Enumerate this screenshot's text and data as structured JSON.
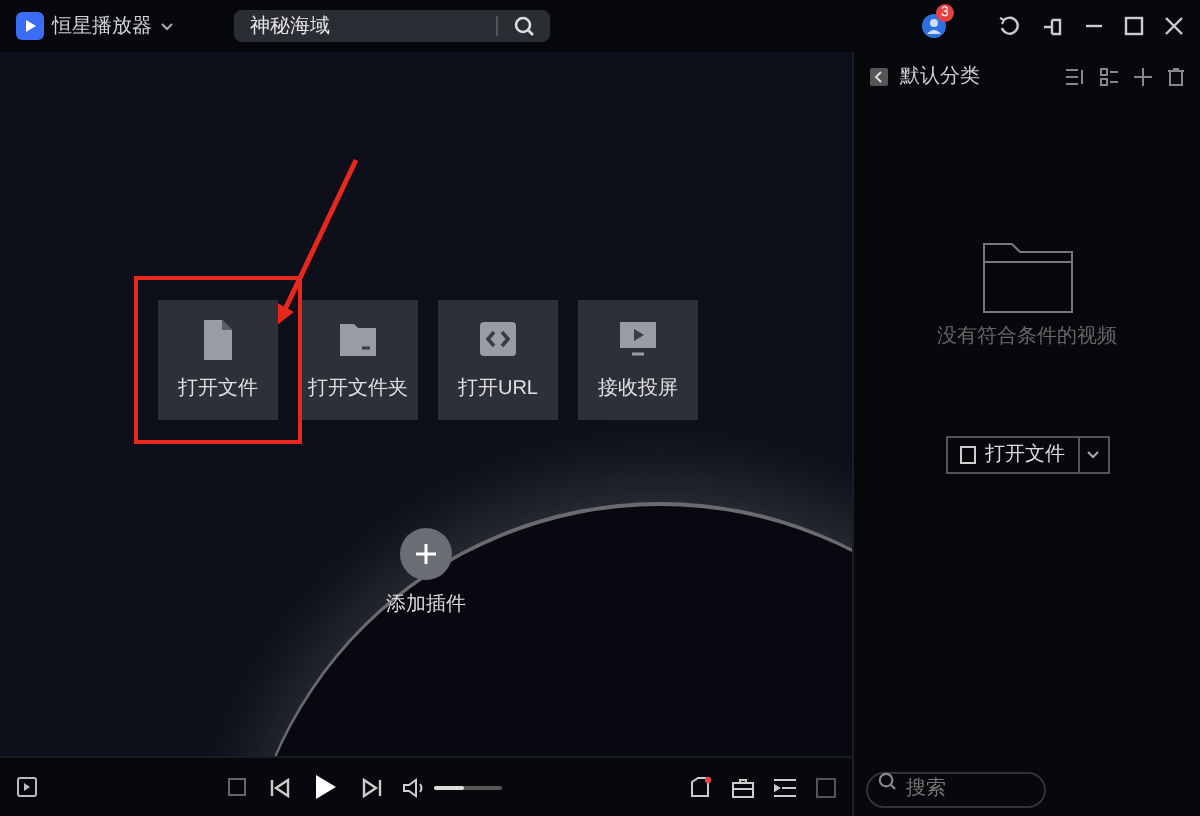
{
  "app": {
    "title": "恒星播放器",
    "search": {
      "value": "神秘海域"
    },
    "notification_count": "3"
  },
  "tiles": [
    {
      "label": "打开文件",
      "selected": true,
      "kind": "file"
    },
    {
      "label": "打开文件夹",
      "selected": false,
      "kind": "folder"
    },
    {
      "label": "打开URL",
      "selected": false,
      "kind": "url"
    },
    {
      "label": "接收投屏",
      "selected": false,
      "kind": "cast"
    }
  ],
  "plugin": {
    "label": "添加插件"
  },
  "playlist": {
    "title": "默认分类",
    "empty_text": "没有符合条件的视频",
    "open_button": "打开文件",
    "search": {
      "placeholder": "搜索"
    }
  },
  "player": {
    "volume": {
      "level": 0.45
    }
  }
}
